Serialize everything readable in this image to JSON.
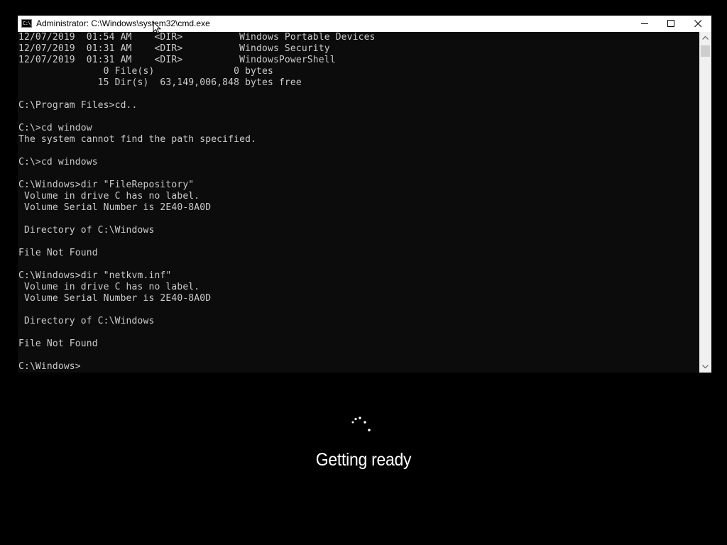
{
  "window": {
    "title": "Administrator: C:\\Windows\\system32\\cmd.exe",
    "icon_text": "C:\\"
  },
  "console": {
    "lines": [
      "12/07/2019  01:54 AM    <DIR>          Windows Portable Devices",
      "12/07/2019  01:31 AM    <DIR>          Windows Security",
      "12/07/2019  01:31 AM    <DIR>          WindowsPowerShell",
      "               0 File(s)              0 bytes",
      "              15 Dir(s)  63,149,006,848 bytes free",
      "",
      "C:\\Program Files>cd..",
      "",
      "C:\\>cd window",
      "The system cannot find the path specified.",
      "",
      "C:\\>cd windows",
      "",
      "C:\\Windows>dir \"FileRepository\"",
      " Volume in drive C has no label.",
      " Volume Serial Number is 2E40-8A0D",
      "",
      " Directory of C:\\Windows",
      "",
      "File Not Found",
      "",
      "C:\\Windows>dir \"netkvm.inf\"",
      " Volume in drive C has no label.",
      " Volume Serial Number is 2E40-8A0D",
      "",
      " Directory of C:\\Windows",
      "",
      "File Not Found",
      "",
      "C:\\Windows>"
    ]
  },
  "setup": {
    "status": "Getting ready"
  },
  "icons": {
    "window_icon": "cmd-icon",
    "minimize": "minimize-icon",
    "maximize": "maximize-icon",
    "close": "close-icon",
    "scroll_up": "chevron-up-icon",
    "scroll_down": "chevron-down-icon",
    "spinner": "loading-spinner-icon"
  },
  "colors": {
    "console_bg": "#0c0c0c",
    "console_fg": "#cccccc",
    "titlebar_bg": "#ffffff",
    "screen_bg": "#000000"
  }
}
